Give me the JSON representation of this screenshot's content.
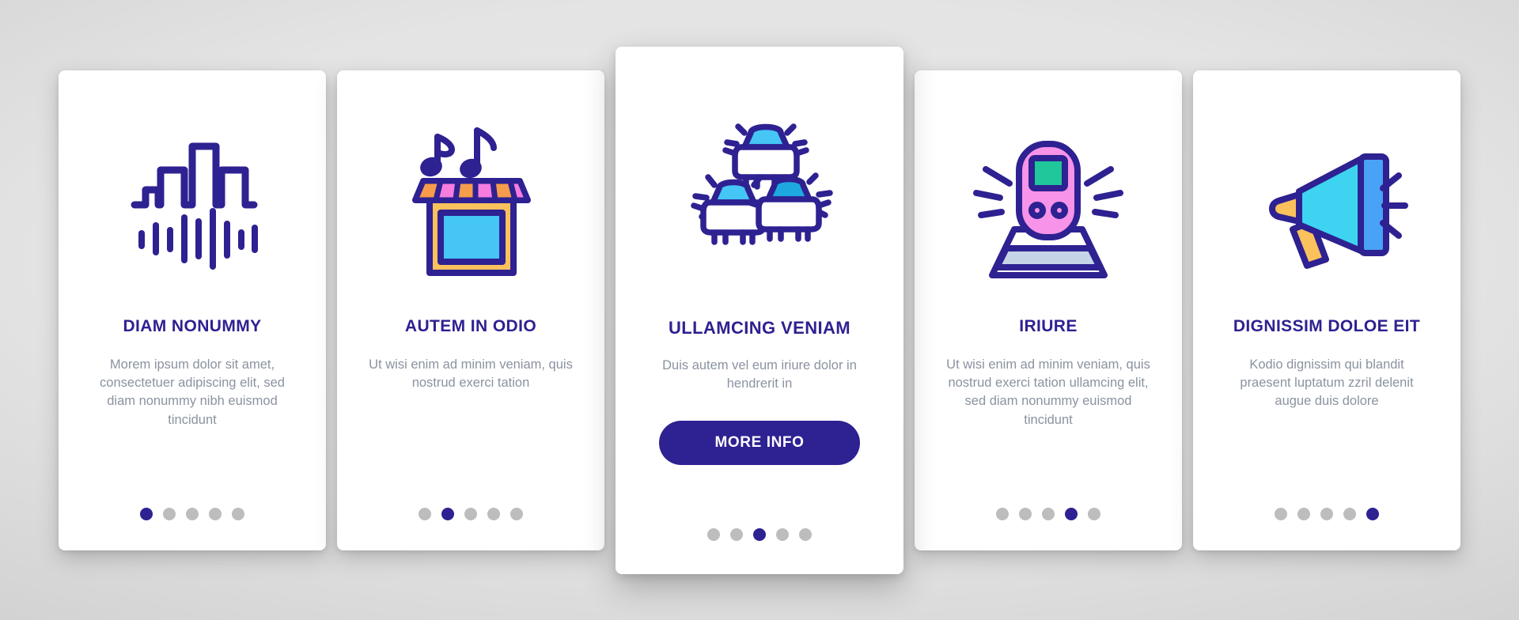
{
  "theme": {
    "accent": "#2e2191",
    "body_text": "#8a93a0",
    "card_bg": "#ffffff",
    "dot_inactive": "#bdbdbd",
    "dot_active": "#2e2191",
    "page_bg": "#d8d8d8"
  },
  "cards": [
    {
      "icon_name": "equalizer-soundwave-icon",
      "title": "DIAM NONUMMY",
      "body": "Morem ipsum dolor sit amet, consectetuer adipiscing elit, sed diam nonummy nibh euismod tincidunt",
      "dots": {
        "count": 5,
        "active_index": 0
      },
      "featured": false,
      "cta_label": ""
    },
    {
      "icon_name": "music-shop-icon",
      "title": "AUTEM IN ODIO",
      "body": "Ut wisi enim ad minim veniam, quis nostrud exerci tation",
      "dots": {
        "count": 5,
        "active_index": 1
      },
      "featured": false,
      "cta_label": ""
    },
    {
      "icon_name": "traffic-cars-icon",
      "title": "ULLAMCING VENIAM",
      "body": "Duis autem vel eum iriure dolor in hendrerit in",
      "dots": {
        "count": 5,
        "active_index": 2
      },
      "featured": true,
      "cta_label": "MORE INFO"
    },
    {
      "icon_name": "train-icon",
      "title": "IRIURE",
      "body": "Ut wisi enim ad minim veniam, quis nostrud exerci tation ullamcing elit, sed diam nonummy euismod tincidunt",
      "dots": {
        "count": 5,
        "active_index": 3
      },
      "featured": false,
      "cta_label": ""
    },
    {
      "icon_name": "megaphone-icon",
      "title": "DIGNISSIM DOLOE EIT",
      "body": "Kodio dignissim qui blandit praesent luptatum zzril delenit augue duis dolore",
      "dots": {
        "count": 5,
        "active_index": 4
      },
      "featured": false,
      "cta_label": ""
    }
  ]
}
